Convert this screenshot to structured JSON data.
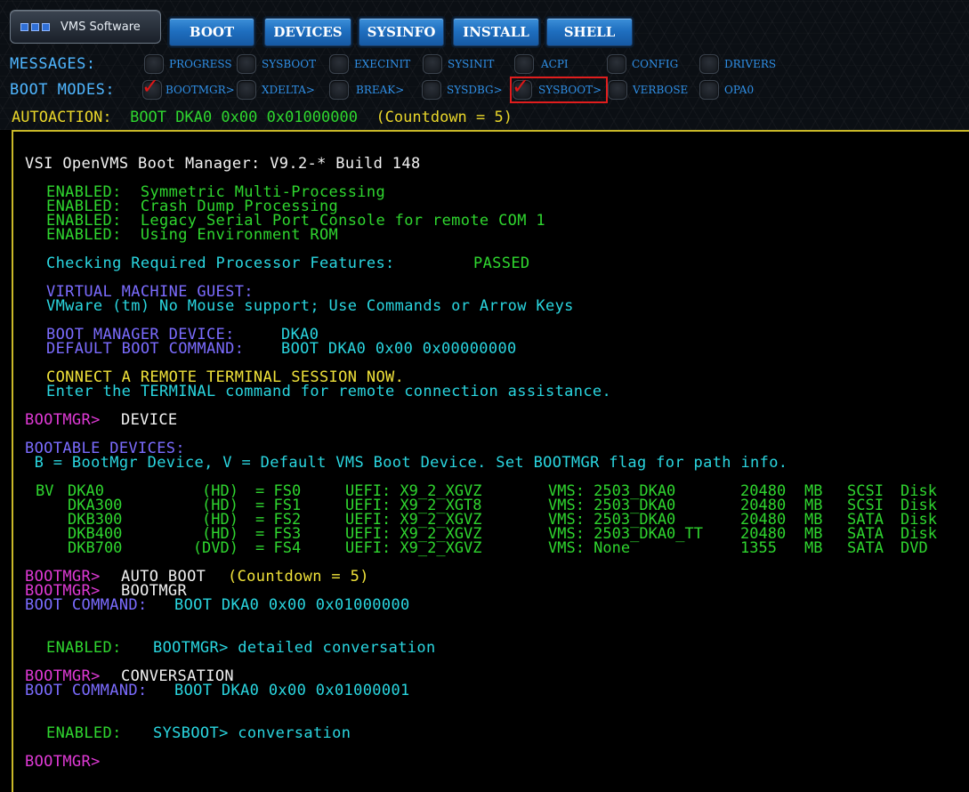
{
  "brand": {
    "title": "VMS Software"
  },
  "menu": [
    {
      "label": "BOOT"
    },
    {
      "label": "DEVICES"
    },
    {
      "label": "SYSINFO"
    },
    {
      "label": "INSTALL"
    },
    {
      "label": "SHELL"
    }
  ],
  "messages": {
    "label": "MESSAGES:",
    "options": [
      {
        "label": "PROGRESS",
        "checked": false
      },
      {
        "label": "SYSBOOT",
        "checked": false
      },
      {
        "label": "EXECINIT",
        "checked": false
      },
      {
        "label": "SYSINIT",
        "checked": false
      },
      {
        "label": "ACPI",
        "checked": false
      },
      {
        "label": "CONFIG",
        "checked": false
      },
      {
        "label": "DRIVERS",
        "checked": false
      }
    ]
  },
  "boot_modes": {
    "label": "BOOT MODES:",
    "options": [
      {
        "label": "BOOTMGR>",
        "checked": true
      },
      {
        "label": "XDELTA>",
        "checked": false
      },
      {
        "label": "BREAK>",
        "checked": false
      },
      {
        "label": "SYSDBG>",
        "checked": false
      },
      {
        "label": "SYSBOOT>",
        "checked": true,
        "highlighted": true
      },
      {
        "label": "VERBOSE",
        "checked": false
      },
      {
        "label": "OPA0",
        "checked": false
      }
    ]
  },
  "autoaction": {
    "label": "AUTOACTION:",
    "value": "BOOT DKA0 0x00 0x01000000",
    "countdown": "(Countdown = 5)"
  },
  "colors": {
    "white": "#f2f2f2",
    "green": "#2fd62f",
    "cyan": "#2ad6e0",
    "purple": "#7b6cff",
    "yellow": "#f0e23a",
    "magenta": "#e03ad6",
    "label_blue": "#4fb6ff",
    "menu_blue": "#1f6fc0",
    "check_red": "#e01616"
  },
  "terminal": {
    "header": "VSI OpenVMS Boot Manager: V9.2-* Build 148",
    "enabled_1": "ENABLED:  Symmetric Multi-Processing",
    "enabled_2": "ENABLED:  Crash Dump Processing",
    "enabled_3": "ENABLED:  Legacy Serial Port Console for remote COM 1",
    "enabled_4": "ENABLED:  Using Environment ROM",
    "check_features": "Checking Required Processor Features:",
    "check_result": "PASSED",
    "vm_guest": "VIRTUAL MACHINE GUEST:",
    "vmware_line": "VMware (tm) No Mouse support; Use Commands or Arrow Keys",
    "bm_device_label": "BOOT MANAGER DEVICE:",
    "bm_device_value": "DKA0",
    "default_cmd_label": "DEFAULT BOOT COMMAND:",
    "default_cmd_value": "BOOT DKA0 0x00 0x00000000",
    "connect_remote": "CONNECT A REMOTE TERMINAL SESSION NOW.",
    "enter_terminal": "Enter the TERMINAL command for remote connection assistance.",
    "prompt": "BOOTMGR>",
    "cmd_device": "DEVICE",
    "bootable_title": "BOOTABLE DEVICES:",
    "bootable_legend": " B = BootMgr Device, V = Default VMS Boot Device. Set BOOTMGR flag for path info.",
    "devices": [
      {
        "flags": "BV",
        "name": "DKA0",
        "type": "(HD)",
        "fs": "= FS0",
        "uefi": "UEFI: X9_2_XGVZ",
        "vms": "VMS: 2503_DKA0",
        "size": "20480",
        "unit": "MB",
        "bus": "SCSI",
        "kind": "Disk"
      },
      {
        "flags": "",
        "name": "DKA300",
        "type": "(HD)",
        "fs": "= FS1",
        "uefi": "UEFI: X9_2_XGT8",
        "vms": "VMS: 2503_DKA0",
        "size": "20480",
        "unit": "MB",
        "bus": "SCSI",
        "kind": "Disk"
      },
      {
        "flags": "",
        "name": "DKB300",
        "type": "(HD)",
        "fs": "= FS2",
        "uefi": "UEFI: X9_2_XGVZ",
        "vms": "VMS: 2503_DKA0",
        "size": "20480",
        "unit": "MB",
        "bus": "SATA",
        "kind": "Disk"
      },
      {
        "flags": "",
        "name": "DKB400",
        "type": "(HD)",
        "fs": "= FS3",
        "uefi": "UEFI: X9_2_XGVZ",
        "vms": "VMS: 2503_DKA0_TT",
        "size": "20480",
        "unit": "MB",
        "bus": "SATA",
        "kind": "Disk"
      },
      {
        "flags": "",
        "name": "DKB700",
        "type": "(DVD)",
        "fs": "= FS4",
        "uefi": "UEFI: X9_2_XGVZ",
        "vms": "VMS: None",
        "size": "1355",
        "unit": "MB",
        "bus": "SATA",
        "kind": "DVD"
      }
    ],
    "cmd_auto_boot": "AUTO BOOT",
    "auto_countdown": "(Countdown = 5)",
    "cmd_bootmgr": "BOOTMGR",
    "boot_cmd_label": "BOOT COMMAND:",
    "boot_cmd_1": "BOOT DKA0 0x00 0x01000000",
    "enabled_bootmgr_label": "ENABLED:",
    "enabled_bootmgr_text": "BOOTMGR> detailed conversation",
    "cmd_conversation": "CONVERSATION",
    "boot_cmd_2": "BOOT DKA0 0x00 0x01000001",
    "enabled_sysboot_label": "ENABLED:",
    "enabled_sysboot_text": "SYSBOOT> conversation"
  }
}
